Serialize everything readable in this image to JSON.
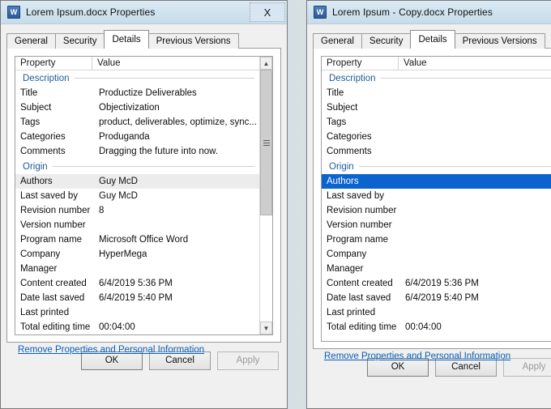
{
  "columns": {
    "property": "Property",
    "value": "Value"
  },
  "sections": {
    "description": "Description",
    "origin": "Origin"
  },
  "tabs": [
    {
      "label": "General"
    },
    {
      "label": "Security"
    },
    {
      "label": "Details"
    },
    {
      "label": "Previous Versions"
    }
  ],
  "buttons": {
    "ok": "OK",
    "cancel": "Cancel",
    "apply": "Apply"
  },
  "link": {
    "label": "Remove Properties and Personal Information"
  },
  "icons": {
    "word": "word-document-icon",
    "close": "close-icon",
    "up": "scroll-up-icon",
    "down": "scroll-down-icon"
  },
  "colors": {
    "selection": "#0b63ce",
    "hover": "#ececec",
    "section_heading": "#1d5a96",
    "link": "#0a5fb5",
    "titlebar": "#cfe2ee"
  },
  "left_window": {
    "title": "Lorem Ipsum.docx Properties",
    "close_label": "X",
    "active_tab": "Details",
    "description_rows": [
      {
        "property": "Title",
        "value": "Productize Deliverables"
      },
      {
        "property": "Subject",
        "value": "Objectivization"
      },
      {
        "property": "Tags",
        "value": "product, deliverables, optimize, sync..."
      },
      {
        "property": "Categories",
        "value": "Produganda"
      },
      {
        "property": "Comments",
        "value": "Dragging the future into now."
      }
    ],
    "origin_rows": [
      {
        "property": "Authors",
        "value": "Guy McD",
        "state": "hover"
      },
      {
        "property": "Last saved by",
        "value": "Guy McD",
        "state": ""
      },
      {
        "property": "Revision number",
        "value": "8",
        "state": ""
      },
      {
        "property": "Version number",
        "value": "",
        "state": ""
      },
      {
        "property": "Program name",
        "value": "Microsoft Office Word",
        "state": ""
      },
      {
        "property": "Company",
        "value": "HyperMega",
        "state": ""
      },
      {
        "property": "Manager",
        "value": "",
        "state": ""
      },
      {
        "property": "Content created",
        "value": "6/4/2019 5:36 PM",
        "state": ""
      },
      {
        "property": "Date last saved",
        "value": "6/4/2019 5:40 PM",
        "state": ""
      },
      {
        "property": "Last printed",
        "value": "",
        "state": ""
      },
      {
        "property": "Total editing time",
        "value": "00:04:00",
        "state": ""
      }
    ]
  },
  "right_window": {
    "title": "Lorem Ipsum - Copy.docx Properties",
    "active_tab": "Details",
    "description_rows": [
      {
        "property": "Title",
        "value": ""
      },
      {
        "property": "Subject",
        "value": ""
      },
      {
        "property": "Tags",
        "value": ""
      },
      {
        "property": "Categories",
        "value": ""
      },
      {
        "property": "Comments",
        "value": ""
      }
    ],
    "origin_rows": [
      {
        "property": "Authors",
        "value": "",
        "state": "selected"
      },
      {
        "property": "Last saved by",
        "value": "",
        "state": ""
      },
      {
        "property": "Revision number",
        "value": "",
        "state": ""
      },
      {
        "property": "Version number",
        "value": "",
        "state": ""
      },
      {
        "property": "Program name",
        "value": "",
        "state": ""
      },
      {
        "property": "Company",
        "value": "",
        "state": ""
      },
      {
        "property": "Manager",
        "value": "",
        "state": ""
      },
      {
        "property": "Content created",
        "value": "6/4/2019 5:36 PM",
        "state": ""
      },
      {
        "property": "Date last saved",
        "value": "6/4/2019 5:40 PM",
        "state": ""
      },
      {
        "property": "Last printed",
        "value": "",
        "state": ""
      },
      {
        "property": "Total editing time",
        "value": "00:04:00",
        "state": ""
      }
    ]
  }
}
